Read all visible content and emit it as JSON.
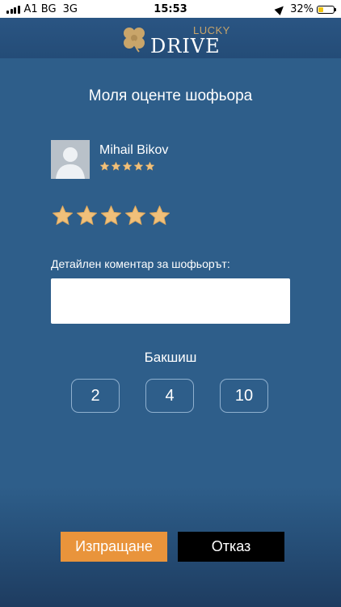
{
  "status_bar": {
    "carrier": "A1 BG",
    "network": "3G",
    "time": "15:53",
    "battery_percent": "32%",
    "battery_level": 0.32,
    "icons": [
      "signal-icon",
      "location-arrow-icon",
      "battery-icon"
    ]
  },
  "header": {
    "logo_lucky": "LUCKY",
    "logo_drive": "DRIVE",
    "logo_icon": "clover-icon"
  },
  "rating": {
    "title": "Моля оценте шофьора",
    "driver_name": "Mihail Bikov",
    "driver_rating": 5,
    "user_rating": 5,
    "max_rating": 5,
    "comment_label": "Детайлен коментар за шофьорът:",
    "comment_value": "",
    "tip_label": "Бакшиш",
    "tip_options": [
      "2",
      "4",
      "10"
    ]
  },
  "actions": {
    "submit_label": "Изпращане",
    "cancel_label": "Отказ"
  },
  "colors": {
    "background": "#2e5e8a",
    "header": "#244c77",
    "accent": "#e9943b",
    "star": "#f0c07a",
    "logo_gold": "#c9a56a"
  }
}
